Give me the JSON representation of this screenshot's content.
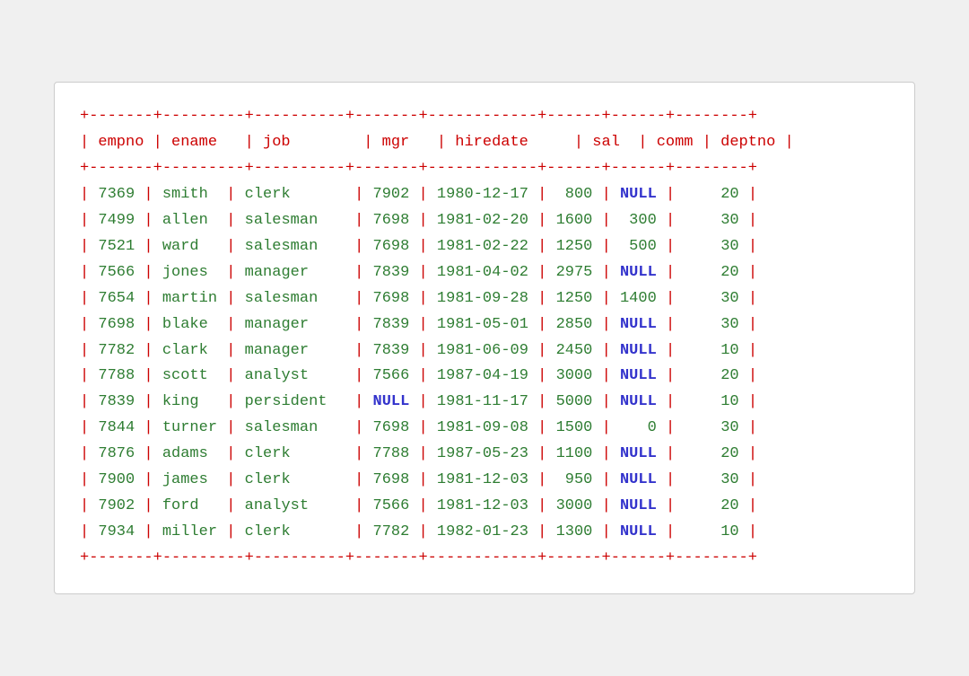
{
  "table": {
    "border": "+-------+---------+----------+-------+------------+------+------+--------+",
    "header": "| empno | ename   | job        | mgr   | hiredate     | sal   | comm  | deptno |",
    "rows": [
      {
        "empno": "7369",
        "ename": "smith ",
        "job": "clerk    ",
        "mgr": "7902",
        "hiredate": "1980-12-17",
        "sal": " 800",
        "comm": "NULL",
        "deptno": "    20"
      },
      {
        "empno": "7499",
        "ename": "allen ",
        "job": "salesman ",
        "mgr": "7698",
        "hiredate": "1981-02-20",
        "sal": "1600",
        "comm": " 300",
        "deptno": "    30"
      },
      {
        "empno": "7521",
        "ename": "ward  ",
        "job": "salesman ",
        "mgr": "7698",
        "hiredate": "1981-02-22",
        "sal": "1250",
        "comm": " 500",
        "deptno": "    30"
      },
      {
        "empno": "7566",
        "ename": "jones ",
        "job": "manager  ",
        "mgr": "7839",
        "hiredate": "1981-04-02",
        "sal": "2975",
        "comm": "NULL",
        "deptno": "    20"
      },
      {
        "empno": "7654",
        "ename": "martin",
        "job": "salesman ",
        "mgr": "7698",
        "hiredate": "1981-09-28",
        "sal": "1250",
        "comm": "1400",
        "deptno": "    30"
      },
      {
        "empno": "7698",
        "ename": "blake ",
        "job": "manager  ",
        "mgr": "7839",
        "hiredate": "1981-05-01",
        "sal": "2850",
        "comm": "NULL",
        "deptno": "    30"
      },
      {
        "empno": "7782",
        "ename": "clark ",
        "job": "manager  ",
        "mgr": "7839",
        "hiredate": "1981-06-09",
        "sal": "2450",
        "comm": "NULL",
        "deptno": "    10"
      },
      {
        "empno": "7788",
        "ename": "scott ",
        "job": "analyst  ",
        "mgr": "7566",
        "hiredate": "1987-04-19",
        "sal": "3000",
        "comm": "NULL",
        "deptno": "    20"
      },
      {
        "empno": "7839",
        "ename": "king  ",
        "job": "persident",
        "mgr": "NULL",
        "hiredate": "1981-11-17",
        "sal": "5000",
        "comm": "NULL",
        "deptno": "    10"
      },
      {
        "empno": "7844",
        "ename": "turner",
        "job": "salesman ",
        "mgr": "7698",
        "hiredate": "1981-09-08",
        "sal": "1500",
        "comm": "   0",
        "deptno": "    30"
      },
      {
        "empno": "7876",
        "ename": "adams ",
        "job": "clerk    ",
        "mgr": "7788",
        "hiredate": "1987-05-23",
        "sal": "1100",
        "comm": "NULL",
        "deptno": "    20"
      },
      {
        "empno": "7900",
        "ename": "james ",
        "job": "clerk    ",
        "mgr": "7698",
        "hiredate": "1981-12-03",
        "sal": " 950",
        "comm": "NULL",
        "deptno": "    30"
      },
      {
        "empno": "7902",
        "ename": "ford  ",
        "job": "analyst  ",
        "mgr": "7566",
        "hiredate": "1981-12-03",
        "sal": "3000",
        "comm": "NULL",
        "deptno": "    20"
      },
      {
        "empno": "7934",
        "ename": "miller",
        "job": "clerk    ",
        "mgr": "7782",
        "hiredate": "1982-01-23",
        "sal": "1300",
        "comm": "NULL",
        "deptno": "    10"
      }
    ],
    "null_rows": [
      false,
      false,
      false,
      false,
      false,
      false,
      false,
      false,
      true,
      false,
      false,
      false,
      false,
      false
    ],
    "mgr_null": [
      false,
      false,
      false,
      false,
      false,
      false,
      false,
      false,
      true,
      false,
      false,
      false,
      false,
      false
    ]
  }
}
